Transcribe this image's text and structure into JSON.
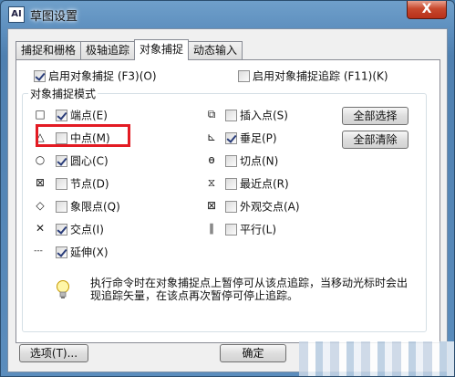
{
  "window": {
    "title": "草图设置",
    "app_icon_text": "AI",
    "close_glyph": "X"
  },
  "tabs": [
    {
      "label": "捕捉和栅格",
      "active": false
    },
    {
      "label": "极轴追踪",
      "active": false
    },
    {
      "label": "对象捕捉",
      "active": true
    },
    {
      "label": "动态输入",
      "active": false
    }
  ],
  "options": {
    "enable_osnap": {
      "label": "启用对象捕捉 (F3)(O)",
      "checked": true
    },
    "enable_osnap_tracking": {
      "label": "启用对象捕捉追踪 (F11)(K)",
      "checked": false
    }
  },
  "group": {
    "title": "对象捕捉模式",
    "left_items": [
      {
        "symbol": "square-endpoint-icon",
        "glyph": "□",
        "label": "端点(E)",
        "checked": true
      },
      {
        "symbol": "triangle-midpoint-icon",
        "glyph": "△",
        "label": "中点(M)",
        "checked": false
      },
      {
        "symbol": "circle-center-icon",
        "glyph": "○",
        "label": "圆心(C)",
        "checked": true
      },
      {
        "symbol": "node-icon",
        "glyph": "⊠",
        "label": "节点(D)",
        "checked": false
      },
      {
        "symbol": "diamond-quadrant-icon",
        "glyph": "◇",
        "label": "象限点(Q)",
        "checked": false
      },
      {
        "symbol": "x-intersection-icon",
        "glyph": "✕",
        "label": "交点(I)",
        "checked": true
      },
      {
        "symbol": "dash-extension-icon",
        "glyph": "---",
        "label": "延伸(X)",
        "checked": true
      }
    ],
    "right_items": [
      {
        "symbol": "insertion-icon",
        "glyph": "⧉",
        "label": "插入点(S)",
        "checked": false
      },
      {
        "symbol": "perpendicular-icon",
        "glyph": "⊾",
        "label": "垂足(P)",
        "checked": true
      },
      {
        "symbol": "tangent-icon",
        "glyph": "ɵ",
        "label": "切点(N)",
        "checked": false
      },
      {
        "symbol": "nearest-icon",
        "glyph": "⧖",
        "label": "最近点(R)",
        "checked": false
      },
      {
        "symbol": "apparent-intersection-icon",
        "glyph": "⊠",
        "label": "外观交点(A)",
        "checked": false
      },
      {
        "symbol": "parallel-icon",
        "glyph": "∥",
        "label": "平行(L)",
        "checked": false
      }
    ],
    "select_all_label": "全部选择",
    "clear_all_label": "全部清除"
  },
  "hint": {
    "icon": "lightbulb-icon",
    "text": "执行命令时在对象捕捉点上暂停可从该点追踪，当移动光标时会出现追踪矢量，在该点再次暂停可停止追踪。"
  },
  "footer": {
    "options_label": "选项(T)...",
    "ok_label": "确定"
  },
  "highlight_color": "#e31b23"
}
